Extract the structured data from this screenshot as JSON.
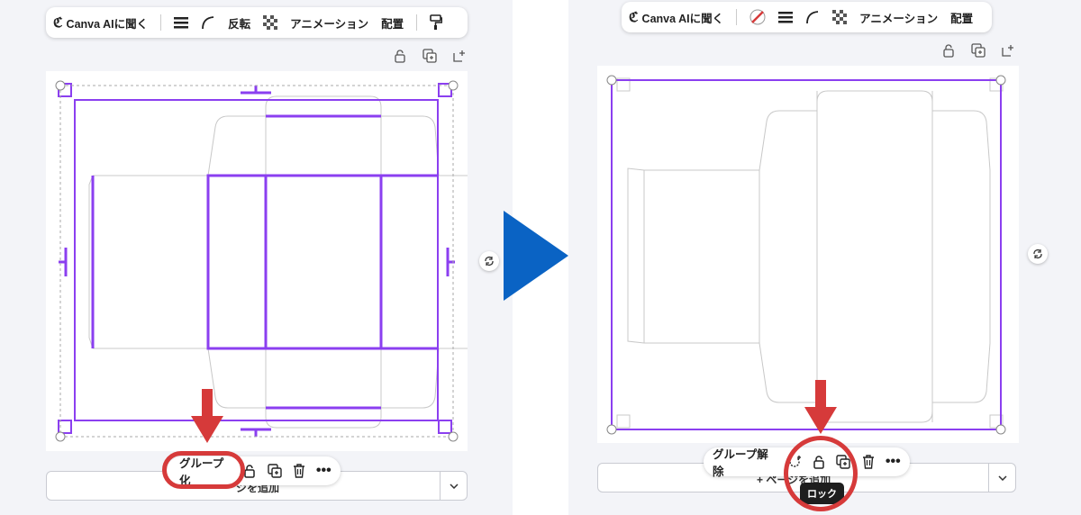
{
  "left_toolbar": {
    "canva_ai_label": "Canva AIに聞く",
    "flip_label": "反転",
    "animation_label": "アニメーション",
    "position_label": "配置"
  },
  "right_toolbar": {
    "canva_ai_label": "Canva AIに聞く",
    "animation_label": "アニメーション",
    "position_label": "配置"
  },
  "left_floatbar": {
    "group_label": "グループ化"
  },
  "right_floatbar": {
    "ungroup_label": "グループ解除",
    "lock_tooltip": "ロック"
  },
  "left_addpage": {
    "label": "ジを追加"
  },
  "right_addpage": {
    "label": "+ ページを追加"
  },
  "colors": {
    "selection": "#8b3ff0",
    "annotation_red": "#d63a3a",
    "arrow_blue": "#0a63c4",
    "panel_bg": "#f3f4f8"
  }
}
